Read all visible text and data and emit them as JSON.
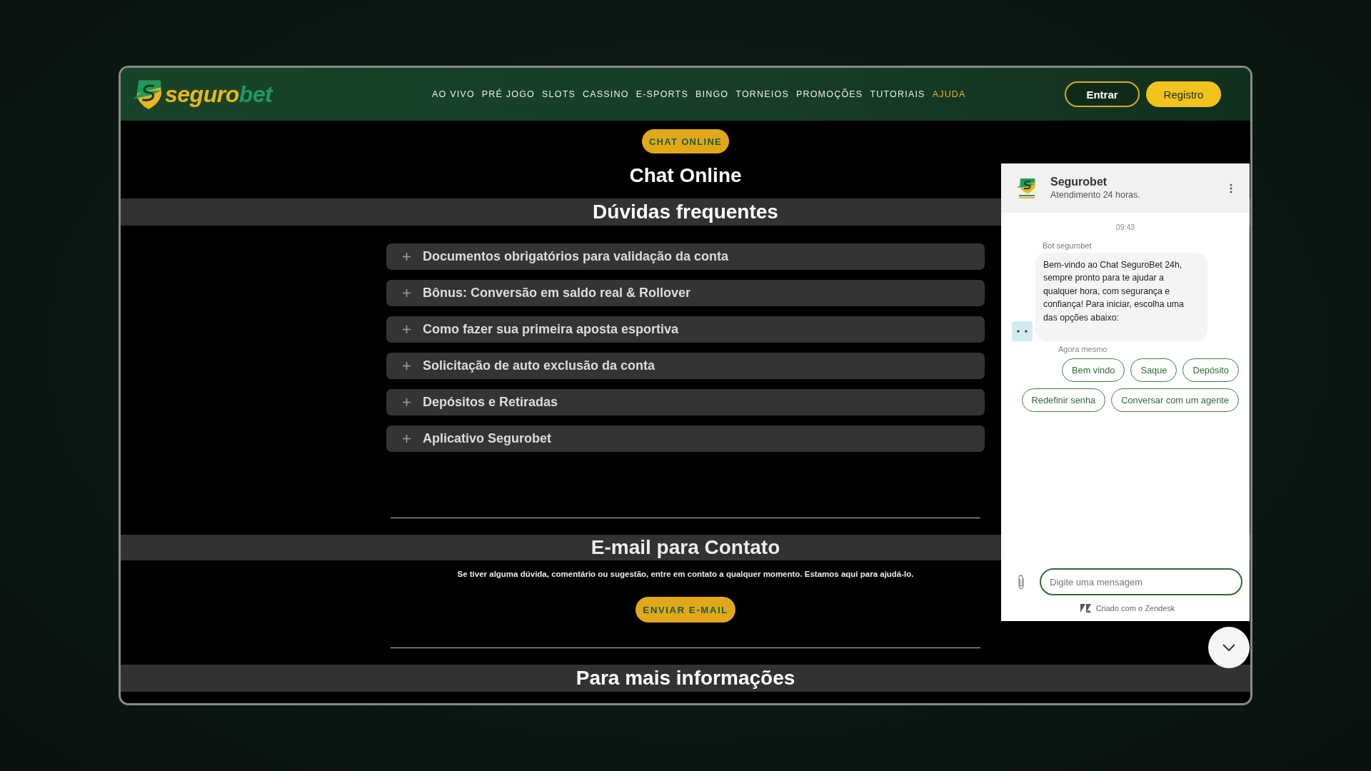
{
  "header": {
    "logo": {
      "parts": [
        "seguro",
        "bet"
      ]
    },
    "nav": [
      {
        "label": "AO VIVO",
        "selected": false
      },
      {
        "label": "PRÉ JOGO",
        "selected": false
      },
      {
        "label": "SLOTS",
        "selected": false
      },
      {
        "label": "CASSINO",
        "selected": false
      },
      {
        "label": "E-SPORTS",
        "selected": false
      },
      {
        "label": "BINGO",
        "selected": false
      },
      {
        "label": "TORNEIOS",
        "selected": false
      },
      {
        "label": "PROMOÇÕES",
        "selected": false
      },
      {
        "label": "TUTORIAIS",
        "selected": false
      },
      {
        "label": "AJUDA",
        "selected": true
      }
    ],
    "buttons": [
      {
        "label": "Entrar",
        "kind": "outline"
      },
      {
        "label": "Registro",
        "kind": "filled"
      }
    ]
  },
  "hero": {
    "badge": "CHAT ONLINE",
    "title": "Chat Online"
  },
  "faq": {
    "title": "Dúvidas frequentes",
    "items": [
      {
        "question": "Documentos obrigatórios para validação da conta",
        "expanded": false
      },
      {
        "question": "Bônus: Conversão em saldo real & Rollover",
        "expanded": false
      },
      {
        "question": "Como fazer sua primeira aposta esportiva",
        "expanded": false
      },
      {
        "question": "Solicitação de auto exclusão da conta",
        "expanded": false
      },
      {
        "question": "Depósitos e Retiradas",
        "expanded": false
      },
      {
        "question": "Aplicativo Segurobet",
        "expanded": false
      }
    ]
  },
  "contact": {
    "title": "E-mail para Contato",
    "text": "Se tiver alguma dúvida, comentário ou sugestão, entre em contato a qualquer momento. Estamos aqui para ajudá-lo.",
    "button": "ENVIAR E-MAIL"
  },
  "more_info": {
    "title": "Para mais informações"
  },
  "chat": {
    "title": "Segurobet",
    "subtitle": "Atendimento 24 horas.",
    "time": "09:43",
    "sender": "Bot segurobet",
    "message": "Bem-vindo ao Chat SeguroBet 24h, sempre pronto para te ajudar a qualquer hora, com segurança e confiança! Para iniciar, escolha uma das opções abaixo:",
    "status": "Agora mesmo",
    "quick_replies": [
      "Bem vindo",
      "Saque",
      "Depósito",
      "Redefinir senha",
      "Conversar com um agente"
    ],
    "input": {
      "placeholder": "Digite uma mensagem"
    },
    "footer": "Criado com o Zendesk"
  }
}
